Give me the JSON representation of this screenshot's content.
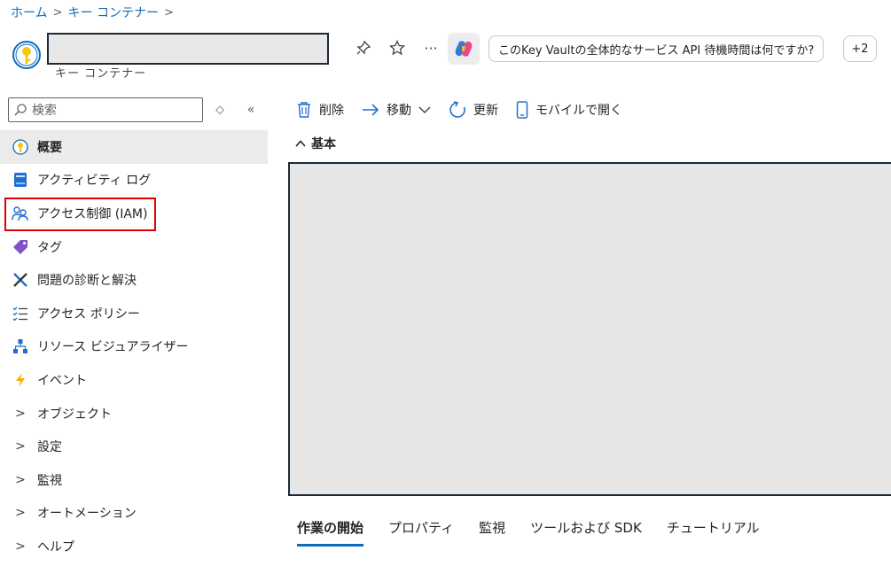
{
  "breadcrumb": {
    "home": "ホーム",
    "container": "キー コンテナー"
  },
  "header": {
    "subtitle": "キー コンテナー",
    "prompt_chip": "このKey Vaultの全体的なサービス API 待機時間は何ですか?",
    "more_chip": "+2"
  },
  "search": {
    "placeholder": "検索"
  },
  "nav": {
    "items": [
      {
        "label": "概要"
      },
      {
        "label": "アクティビティ ログ"
      },
      {
        "label": "アクセス制御 (IAM)"
      },
      {
        "label": "タグ"
      },
      {
        "label": "問題の診断と解決"
      },
      {
        "label": "アクセス ポリシー"
      },
      {
        "label": "リソース ビジュアライザー"
      },
      {
        "label": "イベント"
      },
      {
        "label": "オブジェクト"
      },
      {
        "label": "設定"
      },
      {
        "label": "監視"
      },
      {
        "label": "オートメーション"
      },
      {
        "label": "ヘルプ"
      }
    ]
  },
  "toolbar": {
    "delete": "削除",
    "move": "移動",
    "refresh": "更新",
    "mobile": "モバイルで開く"
  },
  "section": {
    "title": "基本"
  },
  "tabs": [
    "作業の開始",
    "プロパティ",
    "監視",
    "ツールおよび SDK",
    "チュートリアル"
  ],
  "colors": {
    "accent": "#0f6cbd",
    "highlight": "#e00000"
  }
}
